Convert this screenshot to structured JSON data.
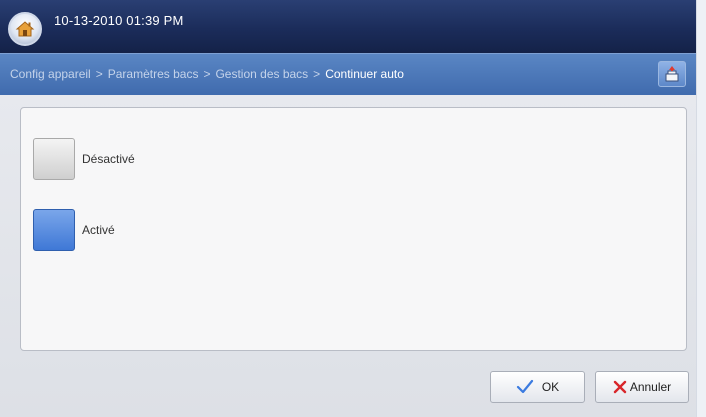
{
  "header": {
    "datetime": "10-13-2010 01:39 PM"
  },
  "breadcrumb": {
    "items": [
      "Config appareil",
      "Paramètres bacs",
      "Gestion des bacs"
    ],
    "current": "Continuer auto",
    "separator": ">"
  },
  "options": [
    {
      "label": "Désactivé",
      "selected": false
    },
    {
      "label": "Activé",
      "selected": true
    }
  ],
  "footer": {
    "ok_label": "OK",
    "cancel_label": "Annuler"
  },
  "icons": {
    "home": "home-icon",
    "job_status": "job-status-icon",
    "ok": "checkmark-icon",
    "cancel": "x-icon"
  },
  "colors": {
    "topbar": "#1b2c5a",
    "navbar": "#4a76b8",
    "selected_option": "#4a80d9",
    "ok_check": "#3b7be0",
    "cancel_x": "#d8262b"
  }
}
